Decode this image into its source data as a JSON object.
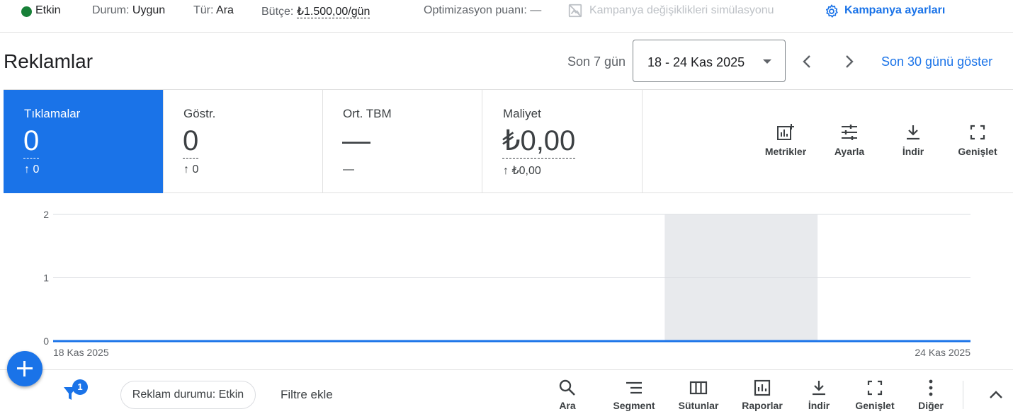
{
  "status_bar": {
    "status": "Etkin",
    "durum_label": "Durum:",
    "durum_value": "Uygun",
    "tur_label": "Tür:",
    "tur_value": "Ara",
    "butce_label": "Bütçe:",
    "butce_value": "₺1.500,00/gün",
    "optimization_label": "Optimizasyon puanı: —",
    "simulation_label": "Kampanya değişiklikleri simülasyonu",
    "campaign_settings_label": "Kampanya ayarları",
    "status_color": "#188038"
  },
  "header": {
    "title": "Reklamlar",
    "period_label": "Son 7 gün",
    "date_range": "18 - 24 Kas 2025",
    "show_30_label": "Son 30 günü göster"
  },
  "metrics": [
    {
      "label": "Tıklamalar",
      "value": "0",
      "change": "↑ 0",
      "active": true
    },
    {
      "label": "Göstr.",
      "value": "0",
      "change": "↑ 0",
      "active": false
    },
    {
      "label": "Ort. TBM",
      "value": "—",
      "change": "—",
      "active": false
    },
    {
      "label": "Maliyet",
      "value": "₺0,00",
      "change": "↑ ₺0,00",
      "active": false
    }
  ],
  "card_tools": {
    "metrics": "Metrikler",
    "adjust": "Ayarla",
    "download": "İndir",
    "expand": "Genişlet"
  },
  "chart_data": {
    "type": "line",
    "x": [
      "18 Kas 2025",
      "19 Kas 2025",
      "20 Kas 2025",
      "21 Kas 2025",
      "22 Kas 2025",
      "23 Kas 2025",
      "24 Kas 2025"
    ],
    "series": [
      {
        "values": [
          0,
          0,
          0,
          0,
          0,
          0,
          0
        ],
        "color": "#1a73e8"
      }
    ],
    "ylim": [
      0,
      2
    ],
    "yticks": [
      "0",
      "1",
      "2"
    ],
    "xtick_labels": [
      "18 Kas 2025",
      "24 Kas 2025"
    ],
    "highlight_range": [
      "22 Kas 2025",
      "23 Kas 2025"
    ],
    "grid": true
  },
  "bottom_bar": {
    "filter_count": "1",
    "status_chip": "Reklam durumu: Etkin",
    "add_filter": "Filtre ekle",
    "tools": {
      "search": "Ara",
      "segment": "Segment",
      "columns": "Sütunlar",
      "reports": "Raporlar",
      "download": "İndir",
      "expand": "Genişlet",
      "more": "Diğer"
    }
  },
  "colors": {
    "accent": "#1a73e8",
    "highlight_band": "#e8eaed"
  }
}
